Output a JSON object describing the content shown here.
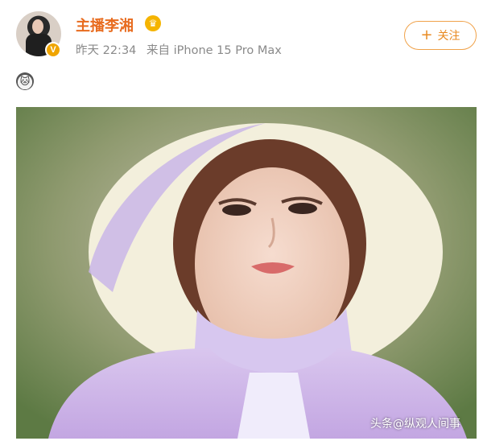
{
  "post": {
    "author": "主播李湘",
    "time": "昨天 22:34",
    "source": "来自 iPhone 15 Pro Max",
    "follow_label": "关注",
    "follow_plus": "+",
    "verified_badge": "V"
  },
  "icons": {
    "crown": "crown-icon",
    "emoji": "emoji-icon"
  },
  "watermark": "头条@纵观人间事",
  "colors": {
    "author": "#e86b1e",
    "follow": "#e8891f",
    "badge": "#f0a500"
  }
}
